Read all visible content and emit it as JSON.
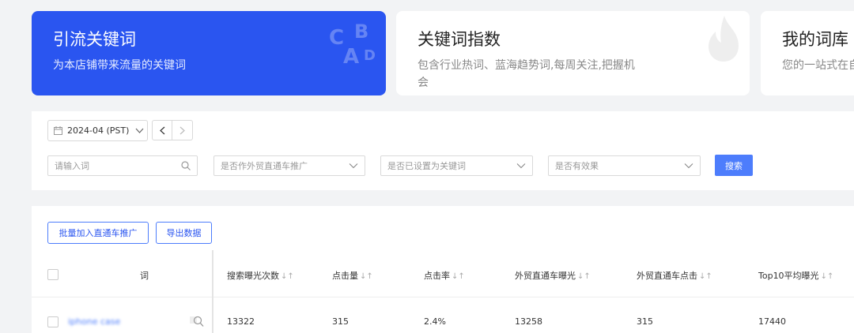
{
  "cards": [
    {
      "title": "引流关键词",
      "desc": "为本店铺带来流量的关键词",
      "active": true,
      "deco_letters": [
        "C",
        "B",
        "A",
        "D"
      ]
    },
    {
      "title": "关键词指数",
      "desc": "包含行业热词、蓝海趋势词,每周关注,把握机会",
      "active": false
    },
    {
      "title": "我的词库",
      "desc": "您的一站式在自定义分组管",
      "active": false
    }
  ],
  "date_picker": {
    "value": "2024-04 (PST)"
  },
  "filters": {
    "word_placeholder": "请输入词",
    "select1": "是否作外贸直通车推广",
    "select2": "是否已设置为关键词",
    "select3": "是否有效果",
    "search_label": "搜索"
  },
  "toolbar": {
    "batch_label": "批量加入直通车推广",
    "export_label": "导出数据"
  },
  "table": {
    "columns": [
      "词",
      "搜索曝光次数",
      "点击量",
      "点击率",
      "外贸直通车曝光",
      "外贸直通车点击",
      "Top10平均曝光"
    ],
    "rows": [
      {
        "word": "iphone case",
        "impressions": "13322",
        "clicks": "315",
        "ctr": "2.4%",
        "p4p_impressions": "13258",
        "p4p_clicks": "315",
        "top10_avg": "17440"
      }
    ]
  },
  "colors": {
    "accent": "#2a55f0",
    "button": "#4d7dfc"
  }
}
